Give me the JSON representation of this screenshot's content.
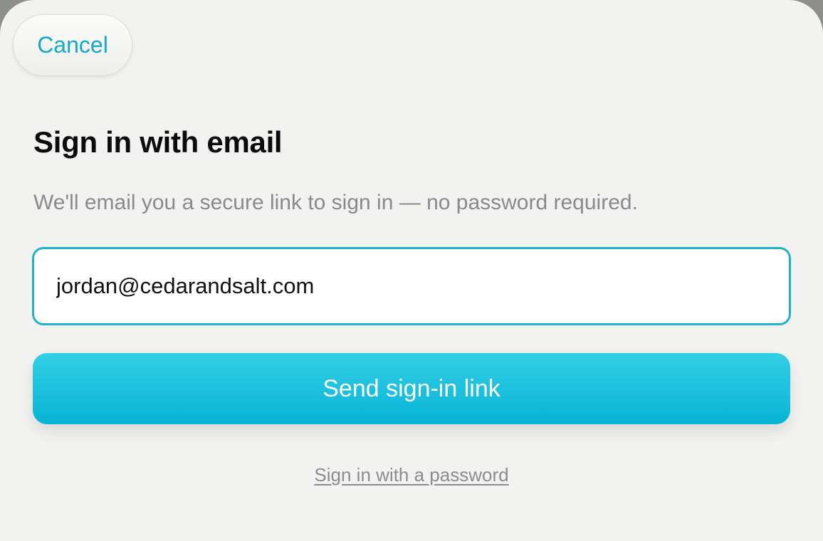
{
  "header": {
    "cancel_label": "Cancel"
  },
  "main": {
    "title": "Sign in with email",
    "subtitle": "We'll email you a secure link to sign in — no password required.",
    "email_value": "jordan@cedarandsalt.com",
    "send_label": "Send sign-in link",
    "alt_link_label": "Sign in with a password"
  },
  "colors": {
    "accent": "#13a9c7",
    "button_gradient_top": "#34cfe6",
    "button_gradient_bottom": "#06b4d6",
    "field_border": "#1fb2cc",
    "sheet_background": "#f2f2f0"
  }
}
